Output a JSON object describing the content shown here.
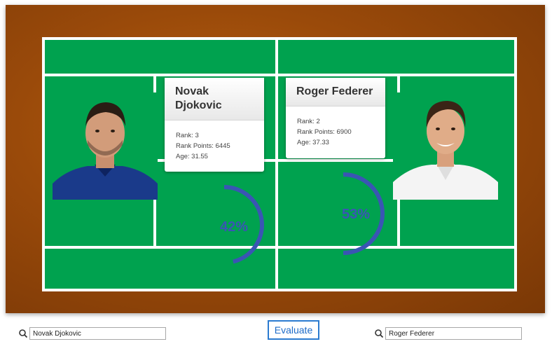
{
  "players": [
    {
      "name": "Novak Djokovic",
      "name_line1": "Novak",
      "name_line2": "Djokovic",
      "rank": "Rank: 3",
      "rank_points": "Rank Points: 6445",
      "age": "Age: 31.55",
      "win_probability": 42,
      "win_label": "42%",
      "shirt_color": "#1a3a8a"
    },
    {
      "name": "Roger Federer",
      "rank": "Rank: 2",
      "rank_points": "Rank Points: 6900",
      "age": "Age: 37.33",
      "win_probability": 53,
      "win_label": "53%",
      "shirt_color": "#ffffff"
    }
  ],
  "search": {
    "left_value": "Novak Djokovic",
    "right_value": "Roger Federer"
  },
  "evaluate_label": "Evaluate",
  "colors": {
    "frame": "#9a4a0a",
    "court": "#00a24f",
    "court_lines": "#ffffff",
    "gauge": "#3a55b4",
    "button": "#2b7bd0"
  }
}
